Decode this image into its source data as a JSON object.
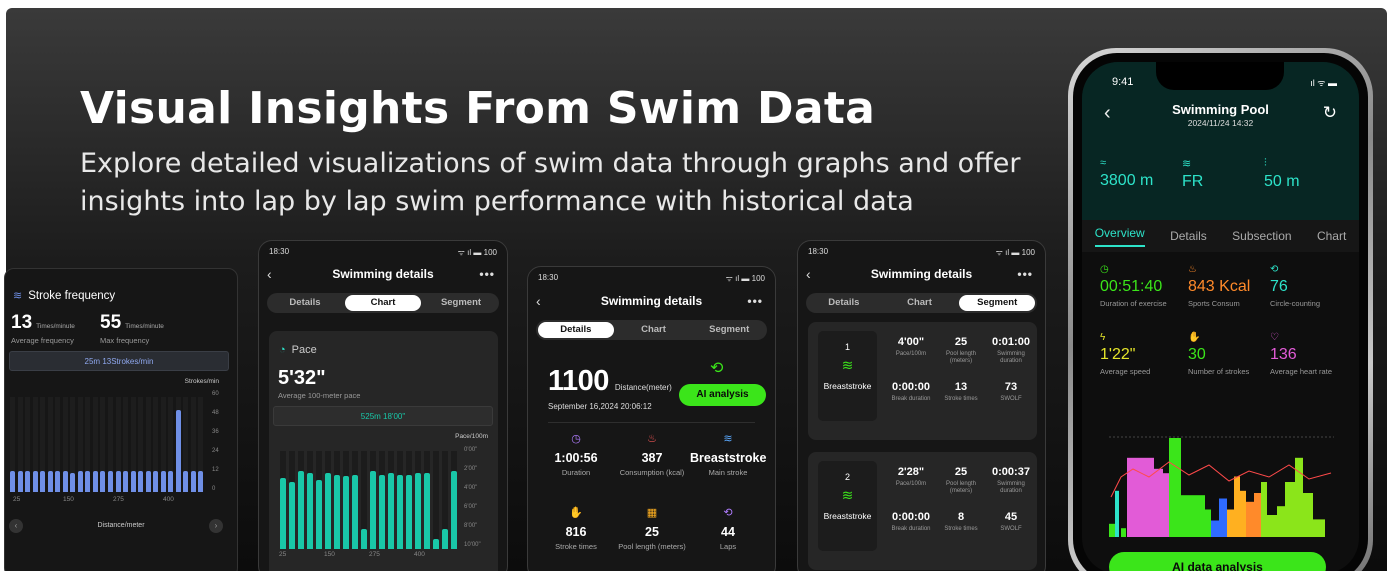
{
  "headline": "Visual Insights From Swim Data",
  "subline": "Explore detailed visualizations of swim data through graphs and offer insights into lap by lap swim performance with historical data",
  "colors": {
    "accent_green": "#3be51a",
    "teal": "#2de3c9",
    "bar_teal": "#19c7a8",
    "bar_blue": "#6f8fe6",
    "orange": "#ff8a2a",
    "pink": "#e25bd7"
  },
  "card1": {
    "title": "Stroke frequency",
    "avg_value": "13",
    "avg_unit": "Times/minute",
    "avg_label": "Average frequency",
    "max_value": "55",
    "max_unit": "Times/minute",
    "max_label": "Max frequency",
    "highlight": "25m 13Strokes/min",
    "y_unit": "Strokes/min",
    "y_ticks": [
      "60",
      "48",
      "36",
      "24",
      "12",
      "0"
    ],
    "x_ticks": [
      "25",
      "150",
      "275",
      "400"
    ],
    "x_label": "Distance/meter",
    "bar_values": [
      13,
      13,
      13,
      13,
      13,
      13,
      13,
      13,
      12,
      13,
      13,
      13,
      13,
      13,
      13,
      13,
      13,
      13,
      13,
      13,
      13,
      13,
      52,
      13,
      13,
      13
    ]
  },
  "card2": {
    "status_time": "18:30",
    "status_battery": "100",
    "title": "Swimming details",
    "tabs": [
      "Details",
      "Chart",
      "Segment"
    ],
    "active_tab": "Chart",
    "section": "Pace",
    "pace_value": "5'32\"",
    "pace_label": "Average 100-meter pace",
    "highlight": "525m 18'00\"",
    "y_unit": "Pace/100m",
    "y_ticks": [
      "0'00\"",
      "2'00\"",
      "4'00\"",
      "6'00\"",
      "8'00\"",
      "10'00\""
    ],
    "x_ticks": [
      "25",
      "150",
      "275",
      "400"
    ],
    "bar_values": [
      0.72,
      0.68,
      0.8,
      0.78,
      0.7,
      0.78,
      0.76,
      0.74,
      0.76,
      0.2,
      0.8,
      0.76,
      0.78,
      0.76,
      0.76,
      0.78,
      0.78,
      0.1,
      0.2,
      0.8
    ]
  },
  "card3": {
    "status_time": "18:30",
    "status_battery": "100",
    "title": "Swimming details",
    "tabs": [
      "Details",
      "Chart",
      "Segment"
    ],
    "active_tab": "Details",
    "distance": "1100",
    "distance_label": "Distance(meter)",
    "date": "September 16,2024 20:06:12",
    "ai_button": "AI analysis",
    "stats": [
      {
        "value": "1:00:56",
        "label": "Duration",
        "icon": "clock-icon"
      },
      {
        "value": "387",
        "label": "Consumption (kcal)",
        "icon": "flame-icon"
      },
      {
        "value": "Breaststroke",
        "label": "Main stroke",
        "icon": "swimmer-icon"
      },
      {
        "value": "816",
        "label": "Stroke times",
        "icon": "hand-icon"
      },
      {
        "value": "25",
        "label": "Pool length (meters)",
        "icon": "pool-icon"
      },
      {
        "value": "44",
        "label": "Laps",
        "icon": "laps-icon"
      }
    ]
  },
  "card4": {
    "status_time": "18:30",
    "status_battery": "100",
    "title": "Swimming details",
    "tabs": [
      "Details",
      "Chart",
      "Segment"
    ],
    "active_tab": "Segment",
    "segments": [
      {
        "index": "1",
        "stroke": "Breaststroke",
        "cells": [
          {
            "value": "4'00\"",
            "label": "Pace/100m"
          },
          {
            "value": "25",
            "label": "Pool length (meters)"
          },
          {
            "value": "0:01:00",
            "label": "Swimming duration"
          },
          {
            "value": "0:00:00",
            "label": "Break duration"
          },
          {
            "value": "13",
            "label": "Stroke times"
          },
          {
            "value": "73",
            "label": "SWOLF"
          }
        ]
      },
      {
        "index": "2",
        "stroke": "Breaststroke",
        "cells": [
          {
            "value": "2'28\"",
            "label": "Pace/100m"
          },
          {
            "value": "25",
            "label": "Pool length (meters)"
          },
          {
            "value": "0:00:37",
            "label": "Swimming duration"
          },
          {
            "value": "0:00:00",
            "label": "Break duration"
          },
          {
            "value": "8",
            "label": "Stroke times"
          },
          {
            "value": "45",
            "label": "SWOLF"
          }
        ]
      }
    ]
  },
  "iphone": {
    "time": "9:41",
    "title": "Swimming Pool",
    "datetime": "2024/11/24 14:32",
    "top_stats": [
      {
        "value": "3800 m",
        "icon": "pool-icon"
      },
      {
        "value": "FR",
        "icon": "swimmer-icon"
      },
      {
        "value": "50 m",
        "icon": "pool-length-icon"
      }
    ],
    "tabs": [
      "Overview",
      "Details",
      "Subsection",
      "Chart"
    ],
    "active_tab": "Overview",
    "metrics": [
      {
        "value": "00:51:40",
        "label": "Duration of exercise",
        "color": "#3be51a",
        "icon": "timer-icon"
      },
      {
        "value": "843 Kcal",
        "label": "Sports Consum",
        "color": "#ff8a2a",
        "icon": "flame-icon"
      },
      {
        "value": "76",
        "label": "Circle-counting",
        "color": "#2de3c9",
        "icon": "loop-icon"
      },
      {
        "value": "1'22\"",
        "label": "Average speed",
        "color": "#e5e52a",
        "icon": "bolt-icon"
      },
      {
        "value": "30",
        "label": "Number of strokes",
        "color": "#3be51a",
        "icon": "hand-icon"
      },
      {
        "value": "136",
        "label": "Average heart rate",
        "color": "#e25bd7",
        "icon": "heart-icon"
      }
    ],
    "ai_button": "AI data analysis"
  }
}
